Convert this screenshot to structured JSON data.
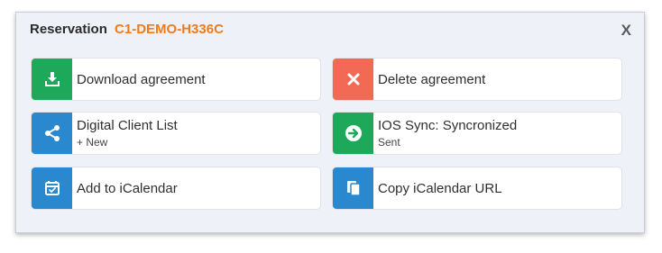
{
  "header": {
    "title": "Reservation",
    "code": "C1-DEMO-H336C",
    "close_label": "X"
  },
  "actions": [
    {
      "label": "Download agreement",
      "icon": "download-icon",
      "color": "#1ea85a"
    },
    {
      "label": "Delete agreement",
      "icon": "close-icon",
      "color": "#f26a55"
    },
    {
      "label": "Digital Client List",
      "sublabel": "+ New",
      "icon": "share-icon",
      "color": "#2a88cf"
    },
    {
      "label": "IOS Sync: Syncronized",
      "sublabel": "Sent",
      "icon": "arrow-right-circle-icon",
      "color": "#1ea85a"
    },
    {
      "label": "Add to iCalendar",
      "icon": "calendar-check-icon",
      "color": "#2a88cf"
    },
    {
      "label": "Copy iCalendar URL",
      "icon": "copy-icon",
      "color": "#2a88cf"
    }
  ]
}
